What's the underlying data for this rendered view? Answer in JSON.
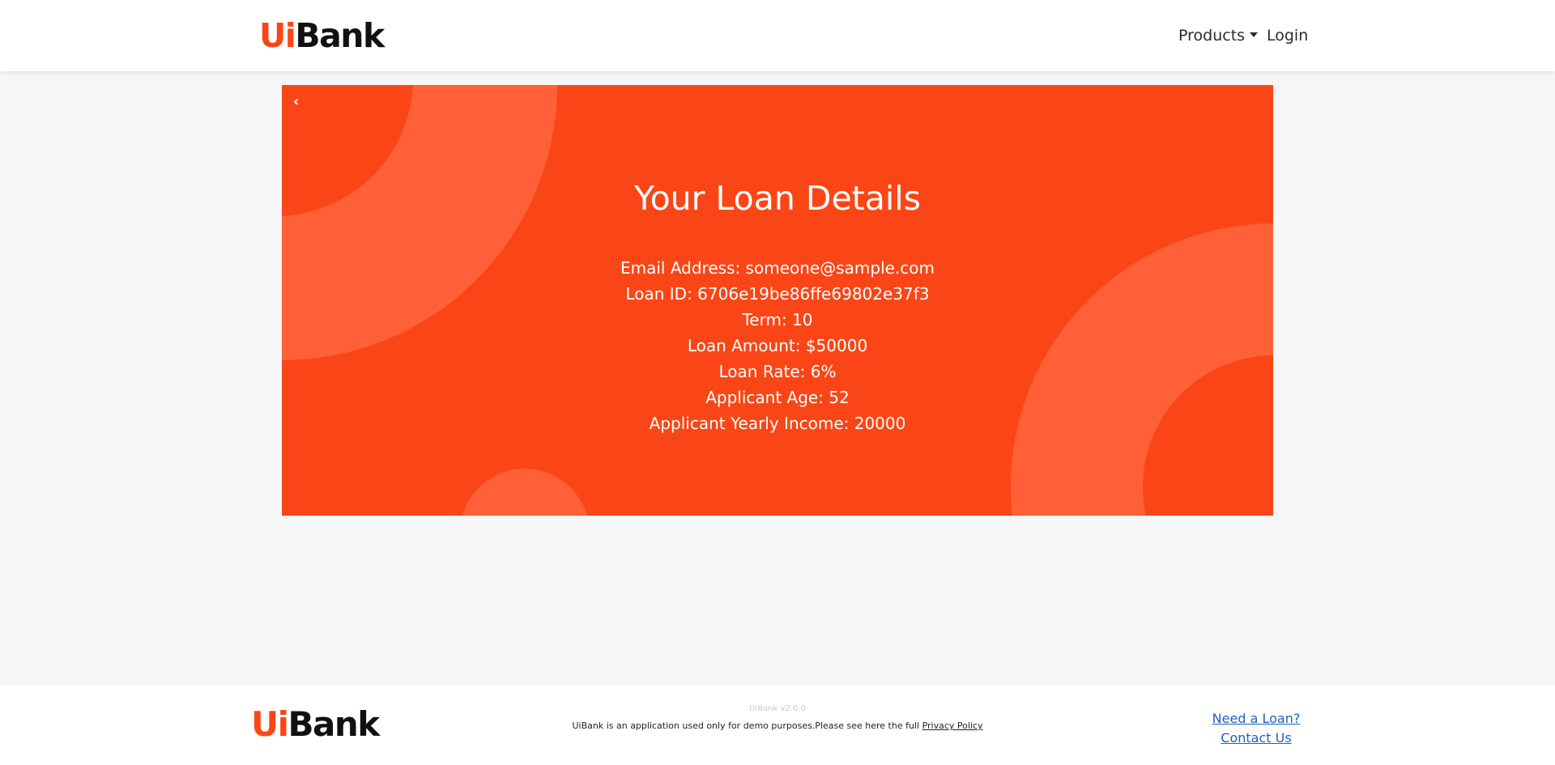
{
  "brand": {
    "ui": "Ui",
    "bank": "Bank",
    "accent": "#fa4616"
  },
  "nav": {
    "products_label": "Products",
    "login_label": "Login"
  },
  "card": {
    "back_icon": "chevron-left-icon",
    "back_glyph": "‹",
    "title": "Your Loan Details",
    "details": [
      "Email Address: someone@sample.com",
      "Loan ID: 6706e19be86ffe69802e37f3",
      "Term: 10",
      "Loan Amount: $50000",
      "Loan Rate: 6%",
      "Applicant Age: 52",
      "Applicant Yearly Income: 20000"
    ]
  },
  "footer": {
    "version": "UiBank v2.0.0",
    "disclaimer": "UiBank is an application used only for demo purposes.Please see here the full ",
    "privacy_link": "Privacy Policy",
    "links": [
      "Need a Loan?",
      "Contact Us"
    ]
  }
}
